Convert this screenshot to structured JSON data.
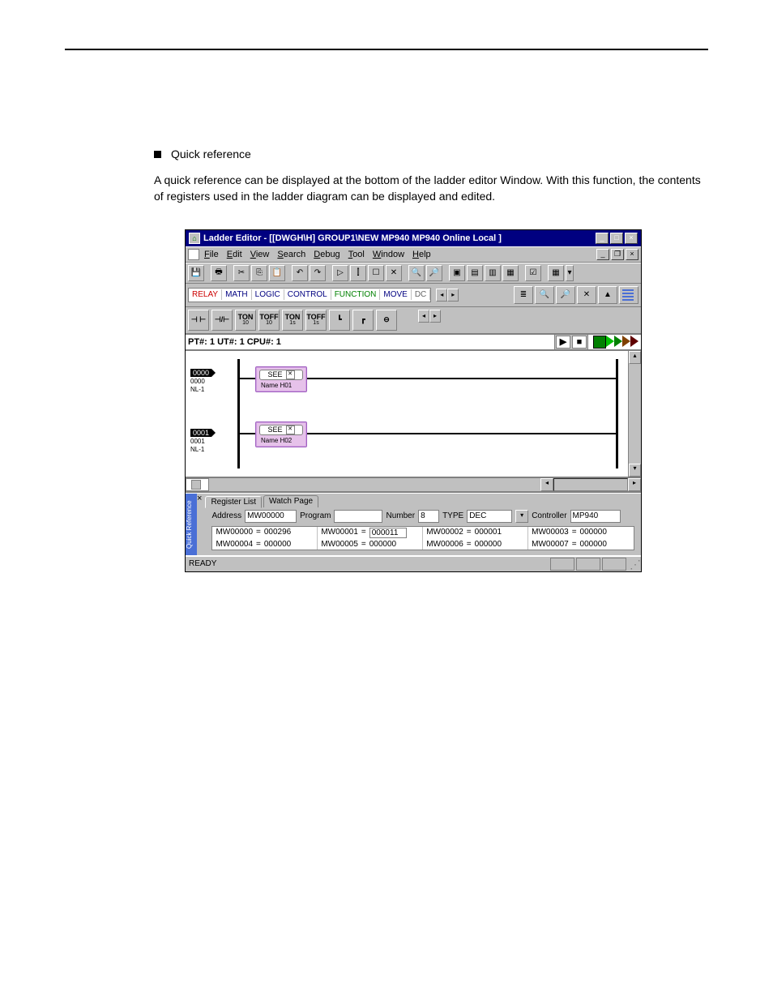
{
  "body_text": {
    "heading": "Quick reference",
    "para": "A quick reference can be displayed at the bottom of the ladder editor Window.  With this function, the contents of registers used in the ladder diagram can be displayed and edited."
  },
  "titlebar": {
    "text": "Ladder Editor - [[DWGH\\H]    GROUP1\\NEW  MP940  MP940      Online  Local  ]"
  },
  "menus": [
    "File",
    "Edit",
    "View",
    "Search",
    "Debug",
    "Tool",
    "Window",
    "Help"
  ],
  "palette_tabs": [
    "RELAY",
    "MATH",
    "LOGIC",
    "CONTROL",
    "FUNCTION",
    "MOVE",
    "DC"
  ],
  "ladder_btns": [
    {
      "top": "⊣ ⊢",
      "sub": ""
    },
    {
      "top": "⊣/⊢",
      "sub": ""
    },
    {
      "top": "TON",
      "sub": "10"
    },
    {
      "top": "TOFF",
      "sub": "10"
    },
    {
      "top": "TON",
      "sub": "1s"
    },
    {
      "top": "TOFF",
      "sub": "1s"
    }
  ],
  "info_bar": "PT#: 1 UT#: 1 CPU#: 1",
  "rungs": [
    {
      "tag": "0000",
      "addr": "0000",
      "nl": "NL-1",
      "block_label": "SEE",
      "block_name": "Name  H01"
    },
    {
      "tag": "0001",
      "addr": "0001",
      "nl": "NL-1",
      "block_label": "SEE",
      "block_name": "Name  H02"
    }
  ],
  "side_handle": "Quick Reference",
  "reg_tabs": [
    "Register List",
    "Watch Page"
  ],
  "form": {
    "addr_label": "Address",
    "addr_value": "MW00000",
    "prog_label": "Program",
    "prog_value": "",
    "num_label": "Number",
    "num_value": "8",
    "type_label": "TYPE",
    "type_value": "DEC",
    "ctrl_label": "Controller",
    "ctrl_value": "MP940"
  },
  "registers": [
    {
      "k": "MW00000",
      "v": "000296",
      "boxed": false
    },
    {
      "k": "MW00001",
      "v": "000011",
      "boxed": true
    },
    {
      "k": "MW00002",
      "v": "000001",
      "boxed": false
    },
    {
      "k": "MW00003",
      "v": "000000",
      "boxed": false
    },
    {
      "k": "MW00004",
      "v": "000000",
      "boxed": false
    },
    {
      "k": "MW00005",
      "v": "000000",
      "boxed": false
    },
    {
      "k": "MW00006",
      "v": "000000",
      "boxed": false
    },
    {
      "k": "MW00007",
      "v": "000000",
      "boxed": false
    }
  ],
  "status": "READY"
}
